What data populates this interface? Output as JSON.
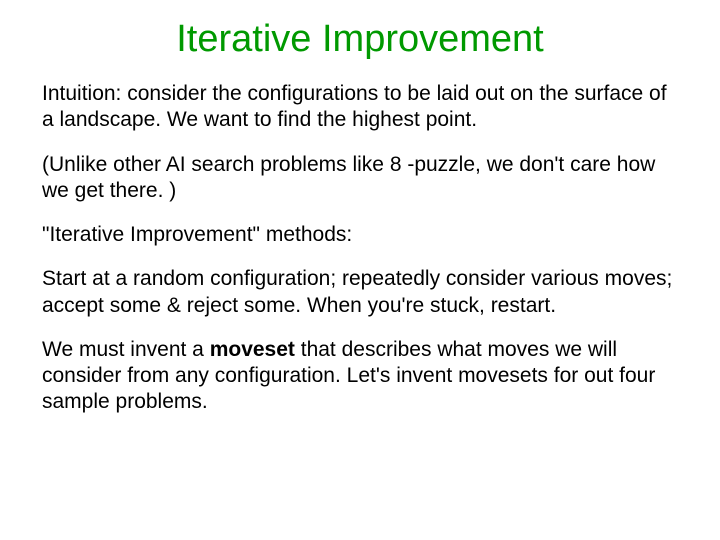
{
  "title": "Iterative Improvement",
  "p1": "Intuition: consider the configurations to be laid out on the surface of a landscape.  We want to find the highest point.",
  "p2": "(Unlike other AI search problems like 8 -puzzle, we don't care how we get there. )",
  "p3": "\"Iterative Improvement\" methods:",
  "p4": "Start at a random configuration; repeatedly consider various moves; accept some & reject some.  When you're stuck, restart.",
  "p5a": "We must invent a ",
  "p5b": "moveset",
  "p5c": " that describes what moves we will consider from any configuration.  Let's invent movesets for out four sample problems."
}
